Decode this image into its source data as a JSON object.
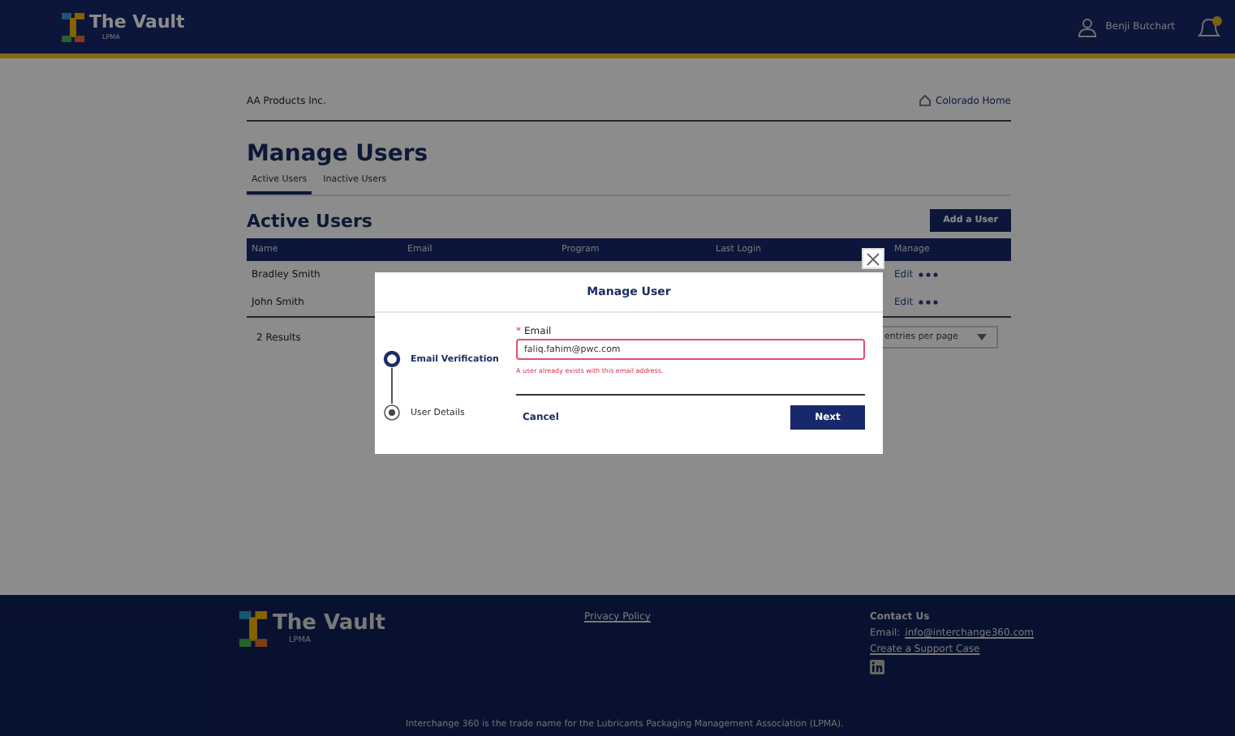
{
  "header": {
    "logo_title": "The Vault",
    "logo_subtitle": "LPMA",
    "user": "Benji Butchart",
    "notification_dot": true
  },
  "breadcrumb": {
    "company": "AA Products Inc.",
    "home_link": "Colorado Home"
  },
  "page_title": "Manage Users",
  "tabs": [
    {
      "label": "Active Users",
      "selected": true
    },
    {
      "label": "Inactive Users",
      "selected": false
    }
  ],
  "section_title": "Active Users",
  "add_button": "Add a User",
  "table": {
    "columns": [
      "Name",
      "Email",
      "Program",
      "Last Login",
      "Manage"
    ],
    "rows": [
      {
        "name": "Bradley Smith",
        "action": "Edit"
      },
      {
        "name": "John Smith",
        "action": "Edit"
      }
    ]
  },
  "results": "2 Results",
  "page_size": {
    "placeholder": "entries per page"
  },
  "modal": {
    "title": "Manage User",
    "steps": [
      {
        "label": "Email Verification",
        "selected": true
      },
      {
        "label": "User Details",
        "selected": false
      }
    ],
    "field": {
      "required_mark": "*",
      "label": "Email",
      "value": "faliq.fahim@pwc.com",
      "error": "A user already exists with this email address."
    },
    "cancel": "Cancel",
    "next": "Next"
  },
  "footer": {
    "logo_title": "The Vault",
    "logo_subtitle": "LPMA",
    "privacy": "Privacy Policy",
    "contact_title": "Contact Us",
    "email_label": "Email:",
    "email": "info@interchange360.com",
    "support": "Create a Support Case",
    "note": "Interchange 360 is the trade name for the Lubricants Packaging Management Association (LPMA)."
  }
}
